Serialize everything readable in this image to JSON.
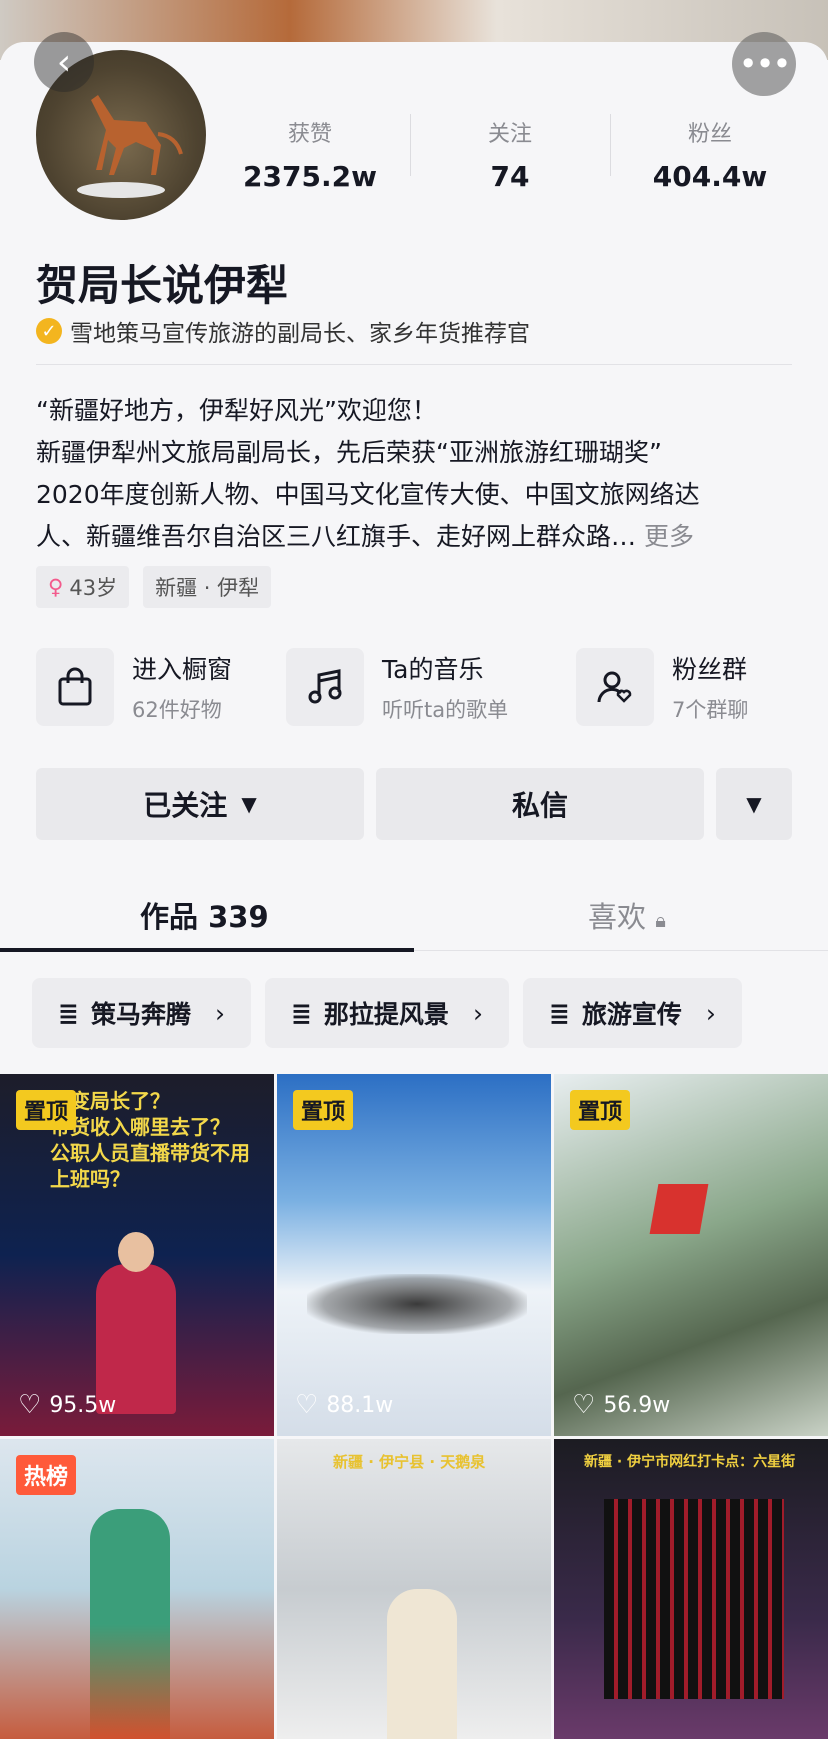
{
  "header": {
    "back_icon": "chevron-left-icon",
    "more_icon": "more-dots-icon"
  },
  "stats": [
    {
      "label": "获赞",
      "value": "2375.2w"
    },
    {
      "label": "关注",
      "value": "74"
    },
    {
      "label": "粉丝",
      "value": "404.4w"
    }
  ],
  "profile": {
    "name": "贺局长说伊犁",
    "verification": "雪地策马宣传旅游的副局长、家乡年货推荐官",
    "bio_lines": [
      "“新疆好地方，伊犁好风光”欢迎您！",
      "新疆伊犁州文旅局副局长，先后荣获“亚洲旅游红珊瑚奖”",
      "2020年度创新人物、中国马文化宣传大使、中国文旅网络达",
      "人、新疆维吾尔自治区三八红旗手、走好网上群众路…"
    ],
    "bio_more": "更多",
    "tags": [
      "43岁",
      "新疆 · 伊犁"
    ]
  },
  "entries": [
    {
      "title": "进入橱窗",
      "sub": "62件好物",
      "icon": "shopping-bag-icon"
    },
    {
      "title": "Ta的音乐",
      "sub": "听听ta的歌单",
      "icon": "music-note-icon"
    },
    {
      "title": "粉丝群",
      "sub": "7个群聊",
      "icon": "fan-group-icon"
    }
  ],
  "actions": {
    "followed": "已关注",
    "message": "私信"
  },
  "tabs": {
    "works": "作品 339",
    "likes": "喜欢"
  },
  "collections": [
    "策马奔腾",
    "那拉提风景",
    "旅游宣传"
  ],
  "videos": [
    {
      "badge": "置顶",
      "likes": "95.5w",
      "caption": "么变局长了？\n带货收入哪里去了？\n公职人员直播带货不用\n上班吗？"
    },
    {
      "badge": "置顶",
      "likes": "88.1w"
    },
    {
      "badge": "置顶",
      "likes": "56.9w"
    },
    {
      "badge": "热榜",
      "likes": ""
    },
    {
      "badge": "",
      "likes": "",
      "caption": "新疆 · 伊宁县 · 天鹅泉"
    },
    {
      "badge": "",
      "likes": "",
      "caption": "新疆 · 伊宁市网红打卡点：六星街"
    }
  ],
  "colors": {
    "accent": "#f3c91f",
    "hot": "#ff5a3a",
    "verify": "#f3b51f"
  }
}
